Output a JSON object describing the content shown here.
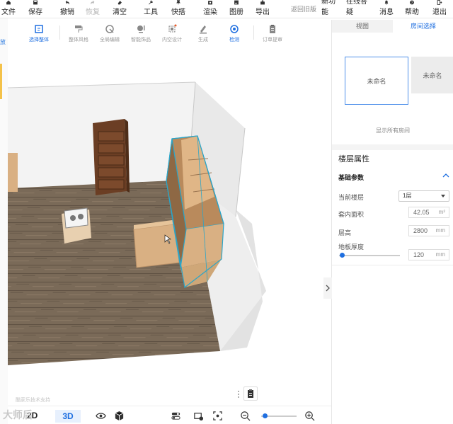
{
  "topbar": {
    "file": "文件",
    "save": "保存",
    "undo": "撤销",
    "redo": "恢复",
    "clear": "清空",
    "tools": "工具",
    "quick": "快搭",
    "render": "渲染",
    "album": "图册",
    "export": "导出",
    "back_old": "返回旧版",
    "new_features": "新功能",
    "online_qa": "在线答疑",
    "messages": "消息",
    "help": "帮助",
    "exit": "退出"
  },
  "leftstrip": {
    "mark": "放"
  },
  "subtoolbar": {
    "select_whole": "选择整体",
    "overall_style": "整体风格",
    "global_edit": "全局编辑",
    "smart_decor": "智能饰品",
    "interior_design": "内空设计",
    "generate": "生成",
    "check": "检测",
    "order_submit": "订单提审"
  },
  "right_panel": {
    "tabs": [
      "视图",
      "房间选择"
    ],
    "room_card_1": "未命名",
    "room_card_2": "未命名",
    "show_all": "显示所有房间",
    "floor_props_title": "楼层属性",
    "basic_params": "基础参数",
    "current_floor_label": "当前楼层",
    "current_floor_value": "1层",
    "area_label": "套内面积",
    "area_value": "42.05",
    "area_unit": "m²",
    "height_label": "层高",
    "height_value": "2800",
    "height_unit": "mm",
    "floor_thickness_label": "地板厚度",
    "floor_thickness_value": "120",
    "floor_thickness_unit": "mm",
    "floor_thickness_slider": 0.05
  },
  "bottombar": {
    "mode_2d": "2D",
    "mode_3d": "3D",
    "zoom_level": 0.1
  },
  "watermark": {
    "main": "大师后",
    "small": "酷家乐技术支持"
  },
  "colors": {
    "accent": "#1f6fe0",
    "floor": "#7a6a58",
    "cabinet": "#d9b083",
    "wall": "#f2f2f2"
  }
}
